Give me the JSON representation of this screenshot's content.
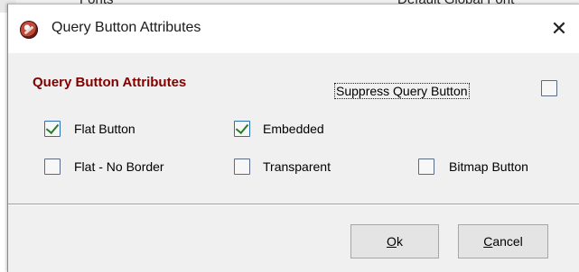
{
  "background_window": {
    "fragment_left": "Fonts",
    "fragment_right": "Default Global Font"
  },
  "dialog": {
    "title": "Query Button Attributes",
    "close_glyph": "✕"
  },
  "content": {
    "group_title": "Query Button Attributes",
    "suppress_label": "Suppress Query Button",
    "suppress_checked": false,
    "options": {
      "flat_button": {
        "label": "Flat Button",
        "checked": true
      },
      "embedded": {
        "label": "Embedded",
        "checked": true
      },
      "flat_no_border": {
        "label": "Flat - No Border",
        "checked": false
      },
      "transparent": {
        "label": "Transparent",
        "checked": false
      },
      "bitmap_button": {
        "label": "Bitmap Button",
        "checked": false
      }
    }
  },
  "buttons": {
    "ok": {
      "mnemonic": "O",
      "rest": "k"
    },
    "cancel": {
      "mnemonic": "C",
      "rest": "ancel"
    }
  },
  "colors": {
    "group_title": "#800000",
    "check_tick": "#2d7a2d",
    "dialog_bg": "#f0f0f0"
  }
}
